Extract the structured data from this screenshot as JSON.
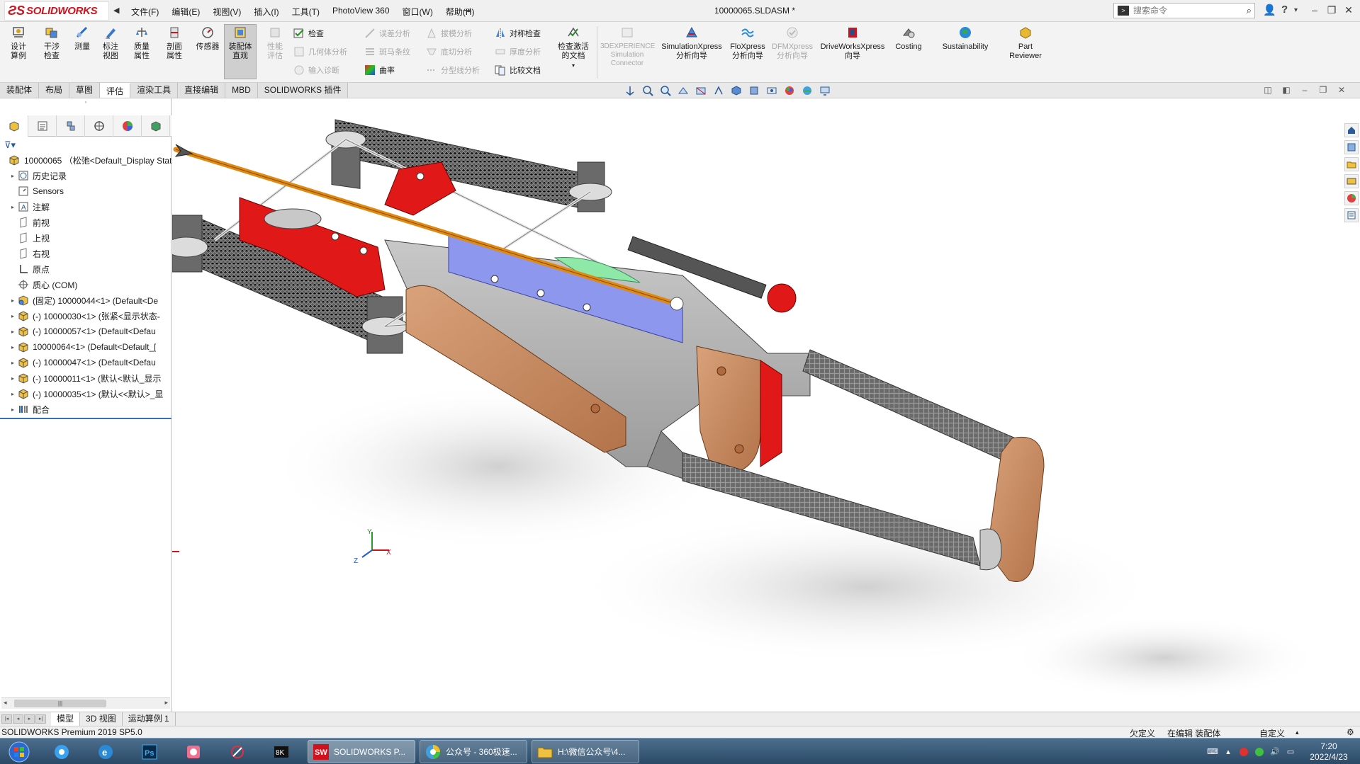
{
  "app": {
    "logo_ds": "ƧS",
    "logo_text": "SOLIDWORKS",
    "document_title": "10000065.SLDASM *"
  },
  "menu": {
    "items": [
      "文件(F)",
      "编辑(E)",
      "视图(V)",
      "插入(I)",
      "工具(T)",
      "PhotoView 360",
      "窗口(W)",
      "帮助(H)"
    ]
  },
  "search": {
    "placeholder": "搜索命令"
  },
  "ribbon": {
    "large_buttons": [
      {
        "label": "设计算例",
        "icon": "design-study-icon",
        "enabled": true
      },
      {
        "label": "干涉检查",
        "icon": "interference-check-icon",
        "enabled": true
      },
      {
        "label": "测量",
        "icon": "measure-icon",
        "enabled": true
      },
      {
        "label": "标注视图",
        "icon": "markup-view-icon",
        "enabled": true
      },
      {
        "label": "质量属性",
        "icon": "mass-properties-icon",
        "enabled": true
      },
      {
        "label": "剖面属性",
        "icon": "section-properties-icon",
        "enabled": true
      },
      {
        "label": "传感器",
        "icon": "sensor-icon",
        "enabled": true
      },
      {
        "label": "装配体直观",
        "icon": "assembly-visualization-icon",
        "enabled": true,
        "active": true
      },
      {
        "label": "性能评估",
        "icon": "performance-evaluation-icon",
        "enabled": false
      }
    ],
    "small_buttons_col1": [
      {
        "label": "检查",
        "icon": "check-icon",
        "enabled": true
      },
      {
        "label": "几何体分析",
        "icon": "geometry-analysis-icon",
        "enabled": false
      },
      {
        "label": "输入诊断",
        "icon": "import-diagnostics-icon",
        "enabled": false
      }
    ],
    "small_buttons_col2": [
      {
        "label": "误差分析",
        "icon": "deviation-analysis-icon",
        "enabled": false
      },
      {
        "label": "斑马条纹",
        "icon": "zebra-stripes-icon",
        "enabled": false
      },
      {
        "label": "曲率",
        "icon": "curvature-icon",
        "enabled": true
      }
    ],
    "small_buttons_col3": [
      {
        "label": "拔模分析",
        "icon": "draft-analysis-icon",
        "enabled": false
      },
      {
        "label": "底切分析",
        "icon": "undercut-analysis-icon",
        "enabled": false
      },
      {
        "label": "分型线分析",
        "icon": "parting-line-icon",
        "enabled": false
      }
    ],
    "small_buttons_col4": [
      {
        "label": "对称检查",
        "icon": "symmetry-check-icon",
        "enabled": true
      },
      {
        "label": "厚度分析",
        "icon": "thickness-analysis-icon",
        "enabled": false
      },
      {
        "label": "比较文档",
        "icon": "compare-documents-icon",
        "enabled": true
      }
    ],
    "right_buttons": [
      {
        "label": "检查激活的文档",
        "icon": "check-active-doc-icon",
        "enabled": true
      },
      {
        "label": "3DEXPERIENCE Simulation Connector",
        "icon": "3dx-simulation-icon",
        "enabled": false
      },
      {
        "label": "SimulationXpress 分析向导",
        "icon": "simulationxpress-icon",
        "enabled": true
      },
      {
        "label": "FloXpress 分析向导",
        "icon": "floxpress-icon",
        "enabled": true
      },
      {
        "label": "DFMXpress 分析向导",
        "icon": "dfmxpress-icon",
        "enabled": false
      },
      {
        "label": "DriveWorksXpress 向导",
        "icon": "driveworksxpress-icon",
        "enabled": true
      },
      {
        "label": "Costing",
        "icon": "costing-icon",
        "enabled": true
      },
      {
        "label": "Sustainability",
        "icon": "sustainability-icon",
        "enabled": true
      },
      {
        "label": "Part Reviewer",
        "icon": "part-reviewer-icon",
        "enabled": true
      }
    ]
  },
  "command_tabs": [
    {
      "label": "装配体",
      "active": false
    },
    {
      "label": "布局",
      "active": false
    },
    {
      "label": "草图",
      "active": false
    },
    {
      "label": "评估",
      "active": true
    },
    {
      "label": "渲染工具",
      "active": false
    },
    {
      "label": "直接编辑",
      "active": false
    },
    {
      "label": "MBD",
      "active": false
    },
    {
      "label": "SOLIDWORKS 插件",
      "active": false
    }
  ],
  "feature_tree": {
    "root": "10000065 （松弛<Default_Display Stat",
    "items": [
      {
        "label": "历史记录",
        "icon": "history-icon",
        "expandable": true
      },
      {
        "label": "Sensors",
        "icon": "sensors-icon",
        "expandable": false
      },
      {
        "label": "注解",
        "icon": "annotations-icon",
        "expandable": true
      },
      {
        "label": "前视",
        "icon": "plane-icon",
        "expandable": false
      },
      {
        "label": "上视",
        "icon": "plane-icon",
        "expandable": false
      },
      {
        "label": "右视",
        "icon": "plane-icon",
        "expandable": false
      },
      {
        "label": "原点",
        "icon": "origin-icon",
        "expandable": false
      },
      {
        "label": "质心 (COM)",
        "icon": "center-of-mass-icon",
        "expandable": false
      },
      {
        "label": "(固定) 10000044<1> (Default<De",
        "icon": "assembly-component-icon",
        "expandable": true
      },
      {
        "label": "(-) 10000030<1> (张紧<显示状态-",
        "icon": "assembly-component-icon",
        "expandable": true
      },
      {
        "label": "(-) 10000057<1> (Default<Defau",
        "icon": "assembly-component-icon",
        "expandable": true
      },
      {
        "label": "10000064<1> (Default<Default_[",
        "icon": "assembly-component-icon",
        "expandable": true
      },
      {
        "label": "(-) 10000047<1> (Default<Defau",
        "icon": "assembly-component-icon",
        "expandable": true
      },
      {
        "label": "(-) 10000011<1> (默认<默认_显示",
        "icon": "assembly-component-icon",
        "expandable": true
      },
      {
        "label": "(-) 10000035<1> (默认<<默认>_显",
        "icon": "assembly-component-icon",
        "expandable": true
      },
      {
        "label": "配合",
        "icon": "mates-icon",
        "expandable": true
      }
    ]
  },
  "triad": {
    "x": "X",
    "y": "Y",
    "z": "Z"
  },
  "bottom_tabs": [
    {
      "label": "模型",
      "active": true
    },
    {
      "label": "3D 视图",
      "active": false
    },
    {
      "label": "运动算例 1",
      "active": false
    }
  ],
  "status": {
    "app_version": "SOLIDWORKS Premium 2019 SP5.0",
    "definition": "欠定义",
    "mode": "在编辑 装配体",
    "units": "自定义"
  },
  "taskbar": {
    "tasks": [
      {
        "label": "SOLIDWORKS P...",
        "icon": "solidworks-task-icon",
        "active": true
      },
      {
        "label": "公众号 - 360极速...",
        "icon": "browser-task-icon",
        "active": false
      },
      {
        "label": "H:\\微信公众号\\4...",
        "icon": "folder-task-icon",
        "active": false
      }
    ],
    "clock_time": "7:20",
    "clock_date": "2022/4/23"
  },
  "colors": {
    "accent_red": "#d1111c",
    "tree_selection": "#3b6fb5",
    "part_red": "#e01818",
    "part_wood": "#c98a62",
    "part_blue": "#8e97ee",
    "arrow_orange": "#e08a16"
  }
}
